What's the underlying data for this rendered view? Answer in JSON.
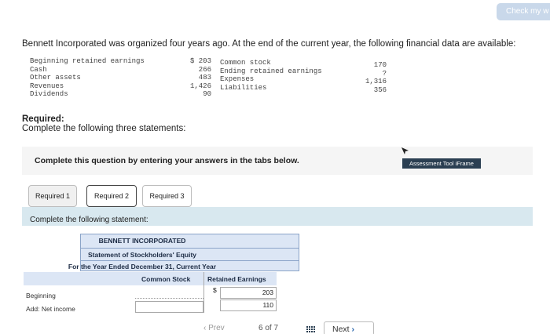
{
  "header": {
    "check_label": "Check my w"
  },
  "intro": "Bennett Incorporated was organized four years ago. At the end of the current year, the following financial data are available:",
  "financial_data": {
    "left_labels": [
      "Beginning retained earnings",
      "Cash",
      "Other assets",
      "Revenues",
      "Dividends"
    ],
    "left_values": [
      "$ 203",
      "266",
      "483",
      "1,426",
      "90"
    ],
    "right_labels": [
      "Common stock",
      "Ending retained earnings",
      "Expenses",
      "Liabilities"
    ],
    "right_values": [
      "170",
      "?",
      "1,316",
      "356"
    ]
  },
  "required": {
    "title": "Required:",
    "subtitle": "Complete the following three statements:"
  },
  "question_prompt": "Complete this question by entering your answers in the tabs below.",
  "assessment_tool_label": "Assessment Tool iFrame",
  "tabs": [
    {
      "label": "Required 1"
    },
    {
      "label": "Required 2"
    },
    {
      "label": "Required 3"
    }
  ],
  "tab_content_title": "Complete the following statement:",
  "statement": {
    "company": "BENNETT INCORPORATED",
    "name": "Statement of Stockholders' Equity",
    "period": "For the Year Ended December 31, Current Year",
    "col_headers": [
      "Common Stock",
      "Retained Earnings"
    ],
    "rows": [
      {
        "label": "Beginning",
        "common_stock": "",
        "currency": "$",
        "retained_earnings": "203"
      },
      {
        "label": "Add: Net income",
        "common_stock": "",
        "currency": "",
        "retained_earnings": "110"
      }
    ]
  },
  "footer": {
    "prev_label": "Prev",
    "page_indicator": "6 of 7",
    "next_label": "Next"
  },
  "colors": {
    "accent_band": "#d8e8ef",
    "statement_header": "#dce6f5",
    "assessment_bg": "#2b3f52"
  }
}
